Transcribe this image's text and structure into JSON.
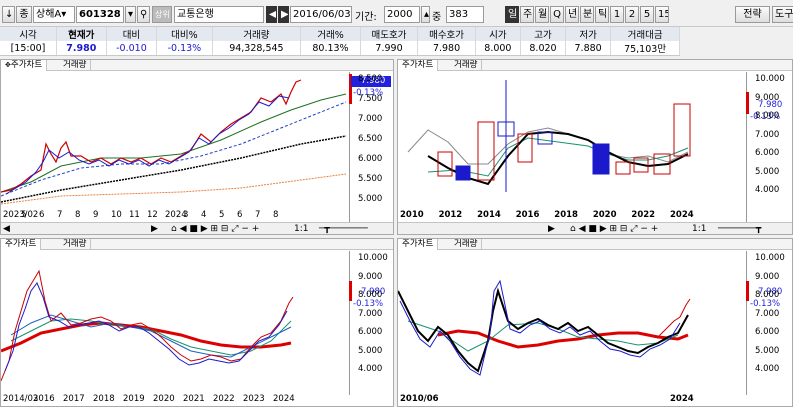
{
  "toolbar": {
    "market": "상해A",
    "code": "601328",
    "status": "상위",
    "name": "교통은행",
    "date": "2016/06/03",
    "period_label": "기간:",
    "period": "2000",
    "count_label": "중",
    "count": "383",
    "timeframes": [
      "일",
      "주",
      "월",
      "Q",
      "년",
      "분",
      "틱",
      "1",
      "2",
      "5",
      "15"
    ],
    "strategy": "전략",
    "tools": "도구"
  },
  "quote": {
    "headers": [
      "시각",
      "현재가",
      "대비",
      "대비%",
      "거래량",
      "거래%",
      "매도호가",
      "매수호가",
      "시가",
      "고가",
      "저가",
      "거래대금"
    ],
    "values": [
      "[15:00]",
      "7.980",
      "-0.010",
      "-0.13%",
      "94,328,545",
      "80.13%",
      "7.990",
      "7.980",
      "8.000",
      "8.020",
      "7.880",
      "75,103만"
    ]
  },
  "panels": {
    "tab_price": "주가차트",
    "tab_volume": "거래량",
    "price_box": "7.980",
    "price_change": "-0.13%",
    "p1": {
      "y_labels": [
        "8.500",
        "7.500",
        "7.000",
        "6.500",
        "6.000",
        "5.500",
        "5.000"
      ],
      "x_labels": [
        "2023/02",
        "5",
        "6",
        "7",
        "8",
        "9",
        "10",
        "11",
        "12",
        "2024",
        "3",
        "4",
        "5",
        "6",
        "7",
        "8"
      ]
    },
    "p2": {
      "y_labels": [
        "10.000",
        "9.000",
        "8.000",
        "7.000",
        "6.000",
        "5.000",
        "4.000"
      ],
      "x_labels": [
        "2010",
        "2012",
        "2014",
        "2016",
        "2018",
        "2020",
        "2022",
        "2024"
      ]
    },
    "p3": {
      "y_labels": [
        "10.000",
        "9.000",
        "8.000",
        "7.000",
        "6.000",
        "5.000",
        "4.000"
      ],
      "x_labels": [
        "2014/03",
        "2016",
        "2017",
        "2018",
        "2019",
        "2020",
        "2021",
        "2022",
        "2023",
        "2024"
      ]
    },
    "p4": {
      "y_labels": [
        "10.000",
        "9.000",
        "8.000",
        "7.000",
        "6.000",
        "5.000",
        "4.000"
      ],
      "x_labels": [
        "2010/06",
        "2024"
      ]
    },
    "scroll_ratio": "1:1"
  }
}
